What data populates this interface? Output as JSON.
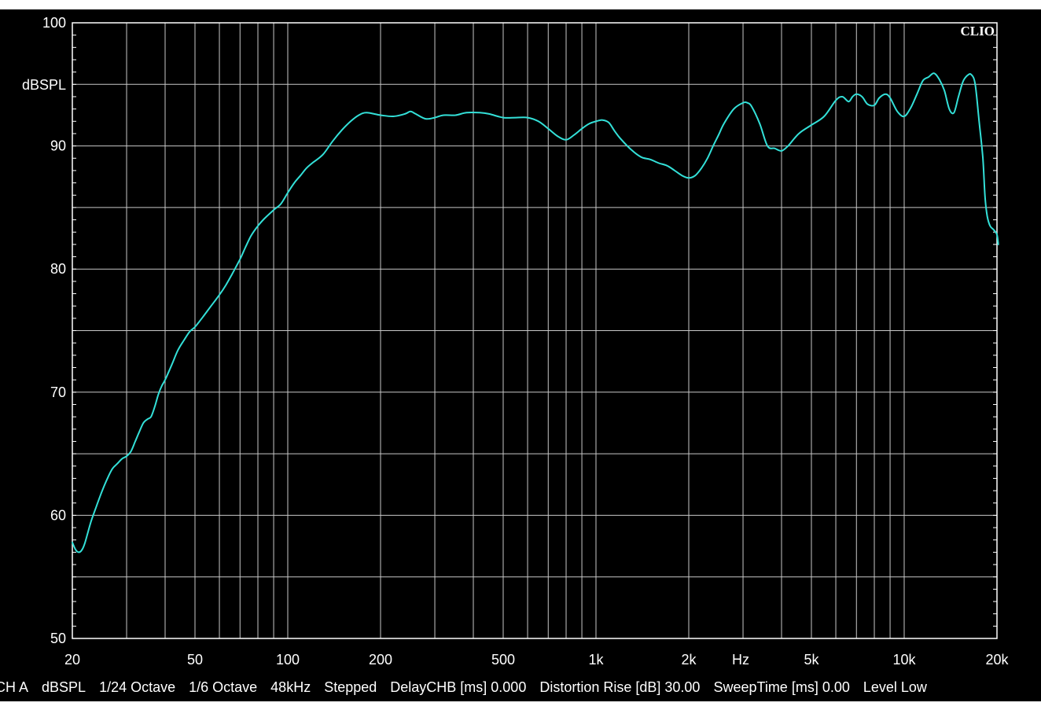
{
  "chart_data": {
    "type": "line",
    "logo": "CLIO",
    "ylabel": "dBSPL",
    "xunit_label": "Hz",
    "xscale": "log",
    "xlim": [
      20,
      20000
    ],
    "ylim": [
      50,
      100
    ],
    "grid": true,
    "xticks": [
      {
        "value": 20,
        "label": "20"
      },
      {
        "value": 50,
        "label": "50"
      },
      {
        "value": 100,
        "label": "100"
      },
      {
        "value": 200,
        "label": "200"
      },
      {
        "value": 500,
        "label": "500"
      },
      {
        "value": 1000,
        "label": "1k"
      },
      {
        "value": 2000,
        "label": "2k"
      },
      {
        "value": 5000,
        "label": "5k"
      },
      {
        "value": 10000,
        "label": "10k"
      },
      {
        "value": 20000,
        "label": "20k"
      }
    ],
    "yticks": [
      {
        "value": 100,
        "label": "100"
      },
      {
        "value": 90,
        "label": "90"
      },
      {
        "value": 80,
        "label": "80"
      },
      {
        "value": 70,
        "label": "70"
      },
      {
        "value": 60,
        "label": "60"
      },
      {
        "value": 50,
        "label": "50"
      }
    ],
    "line_color": "#33e0d8",
    "series": [
      {
        "x": [
          20,
          20.5,
          21,
          21.5,
          22,
          23,
          24,
          25,
          26,
          27,
          28,
          29,
          30,
          31,
          32,
          33,
          34,
          35,
          36,
          37,
          38,
          39,
          40,
          42,
          44,
          46,
          48,
          50,
          53,
          56,
          60,
          63,
          66,
          70,
          73,
          76,
          80,
          84,
          90,
          95,
          100,
          105,
          110,
          115,
          120,
          130,
          140,
          150,
          160,
          170,
          180,
          200,
          220,
          240,
          250,
          260,
          280,
          300,
          320,
          350,
          380,
          420,
          450,
          500,
          550,
          600,
          650,
          700,
          750,
          800,
          850,
          900,
          950,
          1000,
          1050,
          1100,
          1150,
          1200,
          1300,
          1400,
          1500,
          1600,
          1700,
          1800,
          1900,
          2000,
          2100,
          2200,
          2300,
          2400,
          2500,
          2600,
          2800,
          3000,
          3100,
          3200,
          3400,
          3600,
          3800,
          4000,
          4200,
          4400,
          4600,
          5000,
          5500,
          6000,
          6300,
          6600,
          6800,
          7000,
          7300,
          7600,
          8000,
          8300,
          8700,
          9000,
          9500,
          10000,
          10500,
          11000,
          11500,
          12000,
          12500,
          13000,
          13500,
          14000,
          14500,
          15000,
          15500,
          16000,
          16500,
          17000,
          17500,
          18000,
          18300,
          18600,
          19000,
          19500,
          20000,
          20200
        ],
        "y": [
          57.8,
          57.2,
          57.0,
          57.2,
          57.8,
          59.5,
          60.8,
          62.0,
          63.0,
          63.8,
          64.2,
          64.6,
          64.8,
          65.2,
          66.0,
          66.8,
          67.5,
          67.8,
          68.0,
          68.8,
          69.8,
          70.5,
          71.0,
          72.2,
          73.4,
          74.2,
          74.9,
          75.3,
          76.1,
          76.9,
          77.9,
          78.7,
          79.6,
          80.8,
          81.8,
          82.7,
          83.5,
          84.1,
          84.8,
          85.3,
          86.2,
          87.0,
          87.6,
          88.2,
          88.6,
          89.3,
          90.4,
          91.3,
          92.0,
          92.5,
          92.7,
          92.5,
          92.4,
          92.6,
          92.8,
          92.6,
          92.2,
          92.3,
          92.5,
          92.5,
          92.7,
          92.7,
          92.6,
          92.3,
          92.3,
          92.3,
          92.0,
          91.4,
          90.8,
          90.5,
          90.9,
          91.4,
          91.8,
          92.0,
          92.1,
          91.9,
          91.2,
          90.6,
          89.7,
          89.1,
          88.9,
          88.6,
          88.4,
          88.0,
          87.6,
          87.4,
          87.6,
          88.2,
          89.0,
          90.0,
          90.9,
          91.8,
          93.0,
          93.5,
          93.5,
          93.2,
          91.8,
          90.0,
          89.8,
          89.6,
          90.0,
          90.6,
          91.1,
          91.7,
          92.4,
          93.7,
          94.0,
          93.6,
          94.0,
          94.2,
          94.0,
          93.4,
          93.3,
          93.9,
          94.2,
          93.9,
          92.8,
          92.4,
          93.1,
          94.2,
          95.3,
          95.6,
          95.9,
          95.4,
          94.5,
          93.0,
          92.7,
          94.0,
          95.2,
          95.7,
          95.8,
          95.0,
          92.0,
          89.0,
          85.8,
          84.3,
          83.5,
          83.2,
          82.8,
          82.0
        ]
      }
    ]
  },
  "footer": {
    "items": [
      "CH A",
      "dBSPL",
      "1/24 Octave",
      "1/6 Octave",
      "48kHz",
      "Stepped",
      "DelayCHB [ms] 0.000",
      "Distortion Rise [dB] 30.00",
      "SweepTime [ms] 0.00",
      "Level Low"
    ]
  }
}
